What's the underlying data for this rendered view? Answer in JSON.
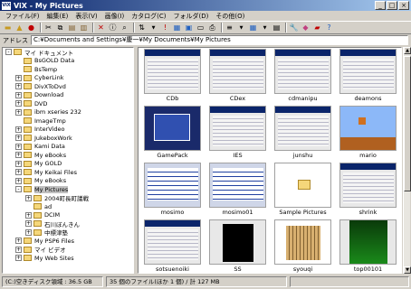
{
  "window": {
    "icon_text": "ViX",
    "title": "ViX - My Pictures"
  },
  "menu": [
    "ファイル(F)",
    "編集(E)",
    "表示(V)",
    "画像(I)",
    "カタログ(C)",
    "フォルダ(D)",
    "その他(O)"
  ],
  "address": {
    "label": "アドレス",
    "value": "C:¥Documents and Settings¥慶一¥My Documents¥My Pictures"
  },
  "tree": [
    {
      "label": "マイ ドキュメント",
      "indent": 0,
      "expander": "-",
      "selected": false
    },
    {
      "label": "BsGOLD Data",
      "indent": 1,
      "expander": "",
      "selected": false
    },
    {
      "label": "BsTemp",
      "indent": 1,
      "expander": "",
      "selected": false
    },
    {
      "label": "CyberLink",
      "indent": 1,
      "expander": "+",
      "selected": false
    },
    {
      "label": "DivXToDvd",
      "indent": 1,
      "expander": "+",
      "selected": false
    },
    {
      "label": "Download",
      "indent": 1,
      "expander": "+",
      "selected": false
    },
    {
      "label": "DVD",
      "indent": 1,
      "expander": "+",
      "selected": false
    },
    {
      "label": "ibm xseries 232",
      "indent": 1,
      "expander": "+",
      "selected": false
    },
    {
      "label": "ImageTmp",
      "indent": 1,
      "expander": "",
      "selected": false
    },
    {
      "label": "InterVideo",
      "indent": 1,
      "expander": "+",
      "selected": false
    },
    {
      "label": "JukeboxWork",
      "indent": 1,
      "expander": "+",
      "selected": false
    },
    {
      "label": "Kami Data",
      "indent": 1,
      "expander": "+",
      "selected": false
    },
    {
      "label": "My eBooks",
      "indent": 1,
      "expander": "+",
      "selected": false
    },
    {
      "label": "My GOLD",
      "indent": 1,
      "expander": "+",
      "selected": false
    },
    {
      "label": "My Keikai Files",
      "indent": 1,
      "expander": "+",
      "selected": false
    },
    {
      "label": "My eBooks",
      "indent": 1,
      "expander": "+",
      "selected": false
    },
    {
      "label": "My Pictures",
      "indent": 1,
      "expander": "-",
      "selected": true
    },
    {
      "label": "2004町長町議戦",
      "indent": 2,
      "expander": "+",
      "selected": false
    },
    {
      "label": "ad",
      "indent": 2,
      "expander": "",
      "selected": false
    },
    {
      "label": "DCIM",
      "indent": 2,
      "expander": "+",
      "selected": false
    },
    {
      "label": "石川ぼんきん",
      "indent": 2,
      "expander": "+",
      "selected": false
    },
    {
      "label": "中標津塾",
      "indent": 2,
      "expander": "+",
      "selected": false
    },
    {
      "label": "My PSP6 Files",
      "indent": 1,
      "expander": "+",
      "selected": false
    },
    {
      "label": "マイ ビデオ",
      "indent": 1,
      "expander": "+",
      "selected": false
    },
    {
      "label": "My Web Sites",
      "indent": 1,
      "expander": "+",
      "selected": false
    }
  ],
  "thumbnails": [
    {
      "caption": "CDb",
      "style": "shot"
    },
    {
      "caption": "CDex",
      "style": "shot"
    },
    {
      "caption": "cdmanipu",
      "style": "shot"
    },
    {
      "caption": "deamons",
      "style": "shot"
    },
    {
      "caption": "GamePack",
      "style": "dark"
    },
    {
      "caption": "IES",
      "style": "shot"
    },
    {
      "caption": "junshu",
      "style": "shot"
    },
    {
      "caption": "mario",
      "style": "game"
    },
    {
      "caption": "mosimo",
      "style": "table"
    },
    {
      "caption": "mosimo01",
      "style": "table"
    },
    {
      "caption": "Sample Pictures",
      "style": "folder"
    },
    {
      "caption": "shrink",
      "style": "shot"
    },
    {
      "caption": "sotsuenoiki",
      "style": "shot"
    },
    {
      "caption": "SS",
      "style": "black"
    },
    {
      "caption": "syouqi",
      "style": "board"
    },
    {
      "caption": "top00101",
      "style": "green"
    }
  ],
  "status": {
    "disk": "(C:)空きディスク領域 : 36.5 GB",
    "files": "35 個のファイル(ほか 1 個) / 計 127 MB"
  },
  "colors": {
    "title_start": "#0a246a",
    "title_end": "#a6caf0",
    "face": "#d4d0c8"
  }
}
